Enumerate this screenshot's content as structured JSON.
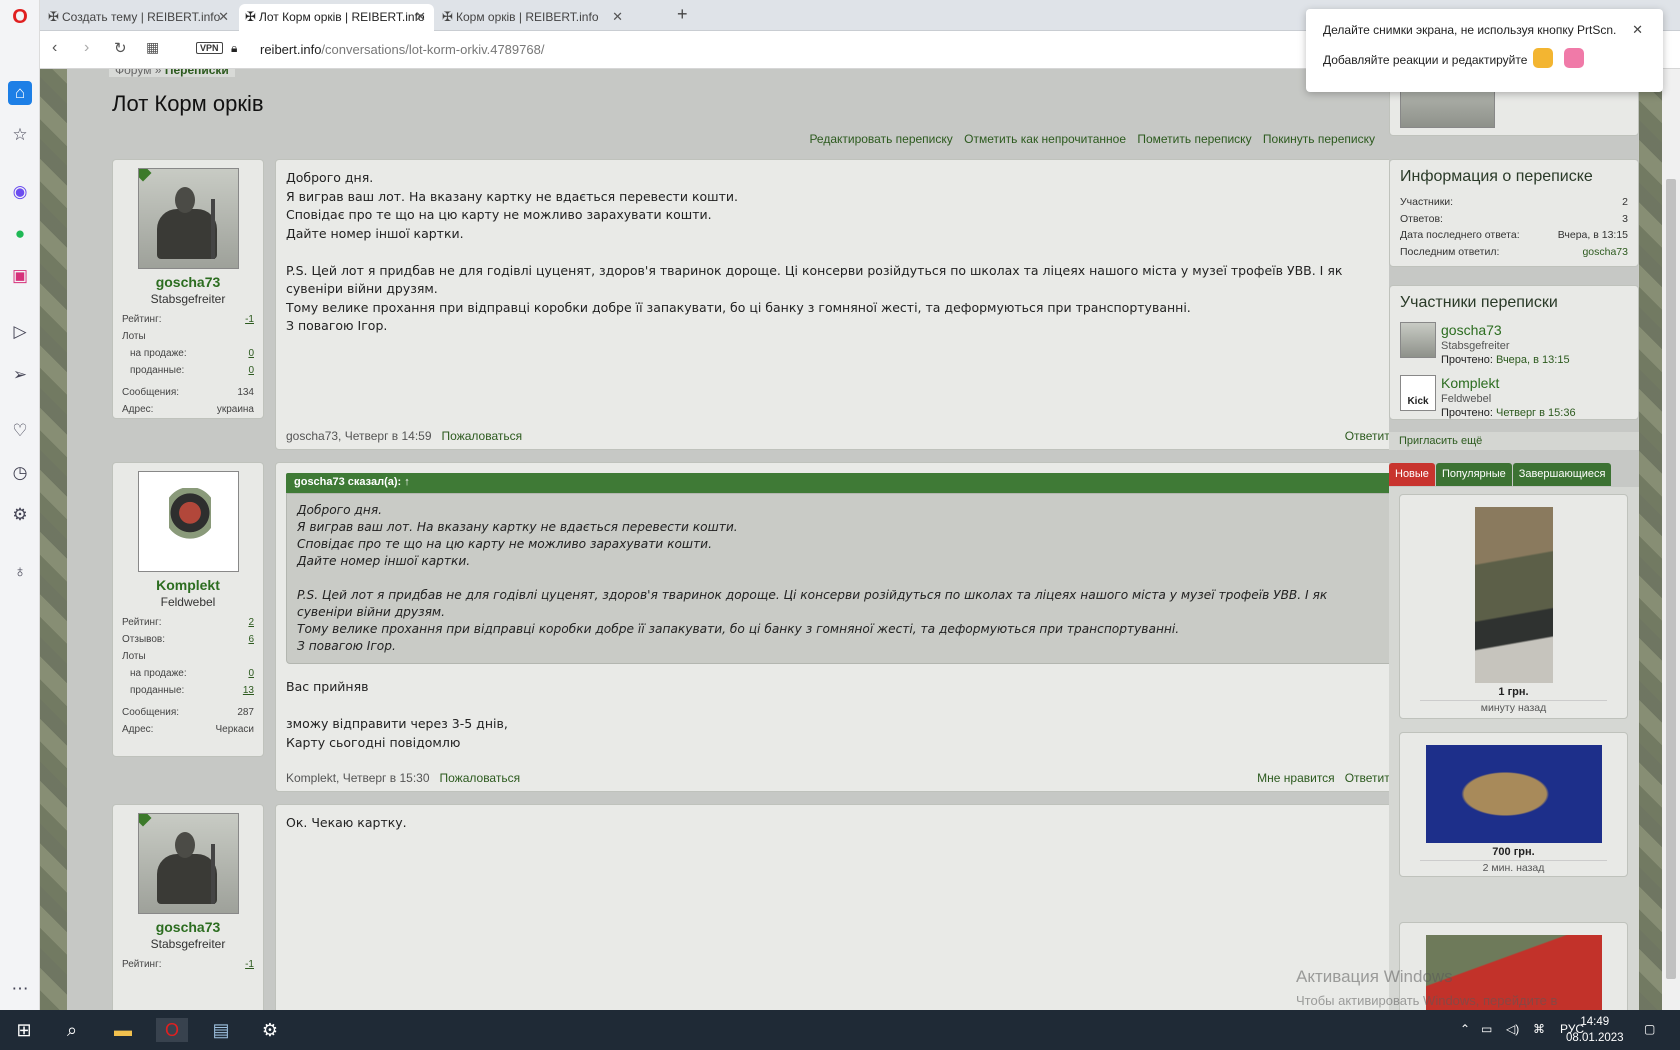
{
  "browser": {
    "tabs": [
      {
        "label": "Создать тему | REIBERT.info"
      },
      {
        "label": "Лот Корм орків | REIBERT.info"
      },
      {
        "label": "Корм орків | REIBERT.info"
      }
    ],
    "vpn": "VPN",
    "url_host": "reibert.info",
    "url_path": "/conversations/lot-korm-orkiv.4789768/"
  },
  "popup": {
    "line1": "Делайте снимки экрана, не используя кнопку PrtScn.",
    "line2": "Добавляйте реакции и редактируйте"
  },
  "breadcrumb": {
    "first": "Форум",
    "sep": "»",
    "second": "Переписки"
  },
  "title": "Лот Корм орків",
  "actions": [
    "Редактировать переписку",
    "Отметить как непрочитанное",
    "Пометить переписку",
    "Покинуть переписку"
  ],
  "users": {
    "goscha": {
      "name": "goscha73",
      "title": "Stabsgefreiter",
      "rating_label": "Рейтинг:",
      "rating": "-1",
      "lots_label": "Лоты",
      "sale_label": "на продаже:",
      "sale": "0",
      "sold_label": "проданные:",
      "sold": "0",
      "msgs_label": "Сообщения:",
      "msgs": "134",
      "addr_label": "Адрес:",
      "addr": "украина"
    },
    "komplekt": {
      "name": "Komplekt",
      "title": "Feldwebel",
      "rating_label": "Рейтинг:",
      "rating": "2",
      "rev_label": "Отзывов:",
      "rev": "6",
      "lots_label": "Лоты",
      "sale_label": "на продаже:",
      "sale": "0",
      "sold_label": "проданные:",
      "sold": "13",
      "msgs_label": "Сообщения:",
      "msgs": "287",
      "addr_label": "Адрес:",
      "addr": "Черкаси"
    }
  },
  "messages": [
    {
      "lines": [
        "Доброго дня.",
        "Я виграв ваш лот. На вказану картку не вдається перевести кошти.",
        "Сповідає про те що на цю карту не можливо зарахувати кошти.",
        "Дайте номер іншої картки.",
        "",
        "P.S. Цей лот я придбав не для годівлі цуценят, здоров'я тваринок дороще. Ці консерви розійдуться по школах та ліцеях нашого міста у музеї трофеїв УВВ. І як сувеніри війни друзям.",
        "Тому велике прохання при відправці коробки добре її запакувати, бо ці банку з гомняної жесті, та деформуються при транспортуванні.",
        "З повагою Ігор."
      ],
      "meta": "goscha73, Четверг в 14:59",
      "report": "Пожаловаться",
      "reply": "Ответить"
    },
    {
      "quote_header": "goscha73 сказал(а): ↑",
      "quote_lines": [
        "Доброго дня.",
        "Я виграв ваш лот. На вказану картку не вдається перевести кошти.",
        "Сповідає про те що на цю карту не можливо зарахувати кошти.",
        "Дайте номер іншої картки.",
        "",
        "P.S. Цей лот я придбав не для годівлі цуценят, здоров'я тваринок дороще. Ці консерви розійдуться по школах та ліцеях нашого міста у музеї трофеїв УВВ. І як сувеніри війни друзям.",
        "Тому велике прохання при відправці коробки добре її запакувати, бо ці банку з гомняної жесті, та деформуються при транспортуванні.",
        "З повагою Ігор."
      ],
      "lines": [
        "Вас прийняв",
        "",
        "зможу відправити через 3-5 днів,",
        "Карту сьогодні повідомлю"
      ],
      "meta": "Komplekt, Четверг в 15:30",
      "report": "Пожаловаться",
      "like": "Мне нравится",
      "reply": "Ответить"
    },
    {
      "lines": [
        "Ок. Чекаю картку."
      ]
    }
  ],
  "info": {
    "title": "Информация о переписке",
    "rows": [
      [
        "Участники:",
        "2"
      ],
      [
        "Ответов:",
        "3"
      ],
      [
        "Дата последнего ответа:",
        "Вчера, в 13:15"
      ],
      [
        "Последним ответил:",
        "goscha73"
      ]
    ]
  },
  "participants": {
    "title": "Участники переписки",
    "list": [
      {
        "name": "goscha73",
        "title": "Stabsgefreiter",
        "read_label": "Прочтено:",
        "read": "Вчера, в 13:15"
      },
      {
        "name": "Komplekt",
        "title": "Feldwebel",
        "read_label": "Прочтено:",
        "read": "Четверг в 15:36",
        "avatar_text": "Kick"
      }
    ],
    "invite": "Пригласить ещё"
  },
  "lot_tabs": [
    "Новые",
    "Популярные",
    "Завершающиеся"
  ],
  "lots": [
    {
      "price": "1 грн.",
      "time": "минуту назад"
    },
    {
      "price": "700 грн.",
      "time": "2 мин. назад"
    }
  ],
  "activation": {
    "line1": "Активация Windows",
    "line2": "Чтобы активировать Windows, перейдите в раздел \"Параметры\"."
  },
  "taskbar": {
    "lang": "РУС",
    "time": "14:49",
    "date": "08.01.2023"
  },
  "colors": {
    "accent_green": "#3c7233",
    "red_tab": "#c8342e",
    "opera_red": "#e02020"
  }
}
